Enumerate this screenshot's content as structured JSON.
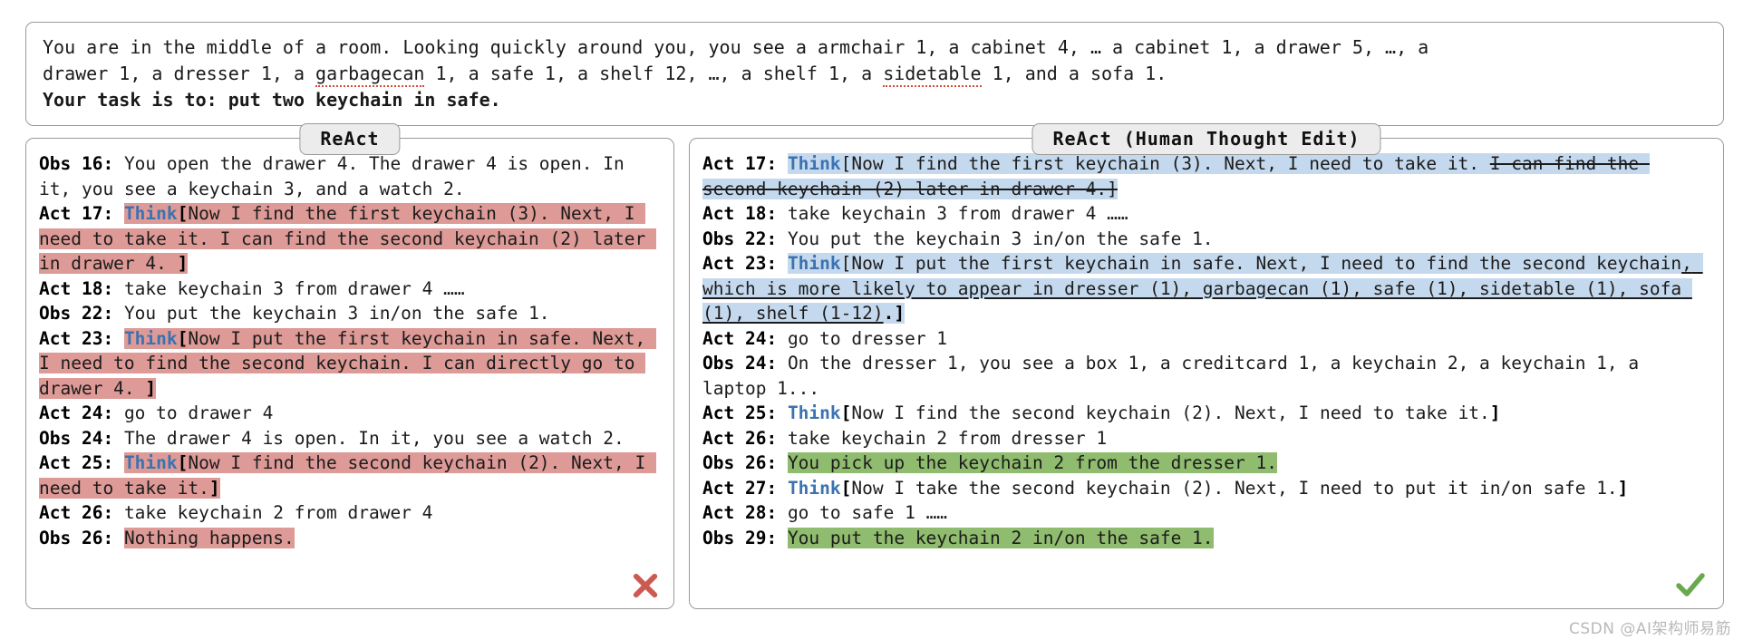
{
  "task": {
    "line1": "You are in the middle of a room. Looking quickly around you, you see a armchair 1, a cabinet 4, … a cabinet 1, a drawer 5, …, a",
    "line2_pre": "drawer 1, a dresser 1, a ",
    "line2_sp": "garbagecan",
    "line2_mid": " 1, a safe 1, a shelf 12, …, a shelf 1, a ",
    "line2_sp2": "sidetable",
    "line2_post": " 1, and a sofa 1.",
    "line3": "Your task is to: put two keychain in safe."
  },
  "left_panel": {
    "title": "ReAct",
    "result_icon": "cross-icon",
    "result_color": "#cc5a50",
    "entries": [
      {
        "label": "Obs 16",
        "text": " You open the drawer 4. The drawer 4 is open. In it, you see a keychain 3, and a watch 2."
      },
      {
        "label": "Act 17",
        "think": "Think",
        "bracket_open": "[",
        "text": "Now I find the first keychain (3). Next, I need to take it. I can find the second keychain (2) later in drawer 4. ",
        "bracket_close": "]",
        "highlight": "red"
      },
      {
        "label": "Act 18",
        "text": " take keychain 3 from drawer 4 ……"
      },
      {
        "label": "Obs 22",
        "text": " You put the keychain 3 in/on the safe 1."
      },
      {
        "label": "Act 23",
        "think": "Think",
        "bracket_open": "[",
        "text": "Now I put the first keychain in safe. Next, I need to find the second keychain. I can directly go to drawer 4. ",
        "bracket_close": "]",
        "highlight": "red"
      },
      {
        "label": "Act 24",
        "text": " go to drawer 4"
      },
      {
        "label": "Obs 24",
        "text": " The drawer 4 is open. In it, you see a watch 2."
      },
      {
        "label": "Act 25",
        "think": "Think",
        "bracket_open": "[",
        "text": "Now I find the second keychain (2). Next, I need to take it.",
        "bracket_close": "]",
        "highlight": "red"
      },
      {
        "label": "Act 26",
        "text": " take keychain 2 from drawer 4"
      },
      {
        "label": "Obs 26",
        "text": "Nothing happens.",
        "highlight": "red"
      }
    ]
  },
  "right_panel": {
    "title": "ReAct (Human Thought Edit)",
    "result_icon": "check-icon",
    "result_color": "#6aa84f",
    "entries": [
      {
        "label": "Act 17",
        "think": "Think",
        "kept": "[Now I find the first keychain (3). Next, I need to take it. ",
        "deleted": "I can find the second keychain (2) later in drawer 4.]",
        "highlight": "blue"
      },
      {
        "label": "Act 18",
        "text": " take keychain 3 from drawer 4 ……"
      },
      {
        "label": "Obs 22",
        "text": " You put the keychain 3 in/on the safe 1."
      },
      {
        "label": "Act 23",
        "think": "Think",
        "kept": "[Now I put the first keychain in safe. Next, I need to find the second keychain",
        "inserted": ", which is more likely to appear in dresser (1), garbagecan (1), safe (1), sidetable (1), sofa (1), shelf (1-12)",
        "kept_tail": ".]",
        "highlight": "blue"
      },
      {
        "label": "Act 24",
        "text": " go to dresser 1"
      },
      {
        "label": "Obs 24",
        "text": " On the dresser 1, you see a box 1, a creditcard 1, a keychain 2, a keychain 1, a laptop 1..."
      },
      {
        "label": "Act 25",
        "think": "Think",
        "bracket_open": "[",
        "text": "Now I find the second keychain (2). Next, I need to take it.",
        "bracket_close": "]"
      },
      {
        "label": "Act 26",
        "text": " take keychain 2 from dresser 1"
      },
      {
        "label": "Obs 26",
        "text": "You pick up the keychain 2 from the dresser 1.",
        "highlight": "green"
      },
      {
        "label": "Act 27",
        "think": "Think",
        "bracket_open": "[",
        "text": "Now I take the second keychain (2). Next, I need to put it in/on safe 1.",
        "bracket_close": "]"
      },
      {
        "label": "Act 28",
        "text": " go to safe 1 ……"
      },
      {
        "label": "Obs 29",
        "text": "You put the keychain 2 in/on the safe 1.",
        "highlight": "green"
      }
    ]
  },
  "watermark": "CSDN @AI架构师易筋"
}
